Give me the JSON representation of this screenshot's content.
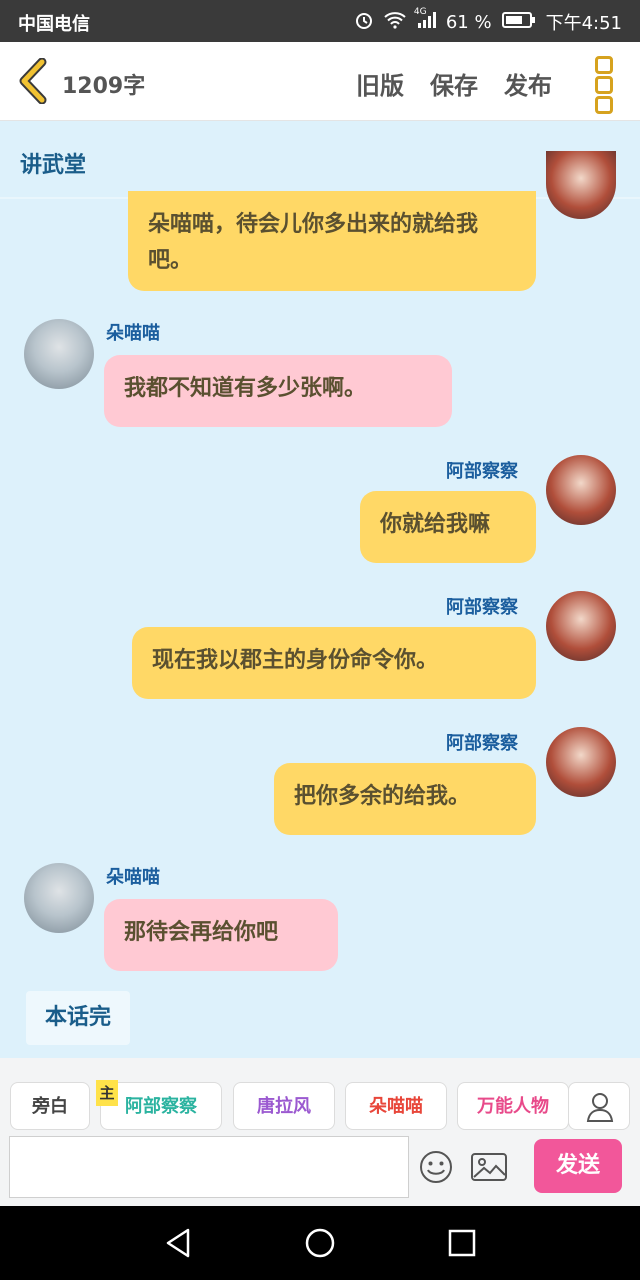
{
  "status_bar": {
    "carrier": "中国电信",
    "network": "4G",
    "battery_percent": "61 %",
    "time": "下午4:51"
  },
  "top_bar": {
    "word_count": "1209字",
    "old_version_label": "旧版",
    "save_label": "保存",
    "publish_label": "发布"
  },
  "channel": {
    "title": "讲武堂"
  },
  "messages": [
    {
      "side": "right",
      "speaker": "",
      "text": "朵喵喵，待会儿你多出来的就给我吧。",
      "color": "yellow"
    },
    {
      "side": "left",
      "speaker": "朵喵喵",
      "text": "我都不知道有多少张啊。",
      "color": "pink"
    },
    {
      "side": "right",
      "speaker": "阿部察察",
      "text": "你就给我嘛",
      "color": "yellow"
    },
    {
      "side": "right",
      "speaker": "阿部察察",
      "text": "现在我以郡主的身份命令你。",
      "color": "yellow"
    },
    {
      "side": "right",
      "speaker": "阿部察察",
      "text": "把你多余的给我。",
      "color": "yellow"
    },
    {
      "side": "left",
      "speaker": "朵喵喵",
      "text": "那待会再给你吧",
      "color": "pink"
    }
  ],
  "end_marker": "本话完",
  "roles": [
    {
      "label": "旁白",
      "color": "#444444"
    },
    {
      "label": "阿部察察",
      "color": "#2bb3a0",
      "tag": "主"
    },
    {
      "label": "唐拉风",
      "color": "#9b59d0"
    },
    {
      "label": "朵喵喵",
      "color": "#e8463a"
    },
    {
      "label": "万能人物",
      "color": "#e84a8a"
    }
  ],
  "composer": {
    "input_value": "",
    "send_label": "发送"
  },
  "colors": {
    "accent_yellow": "#ffd866",
    "accent_pink": "#ffc9d3",
    "send_pink": "#f2579a",
    "chat_bg": "#ddf1fb"
  }
}
